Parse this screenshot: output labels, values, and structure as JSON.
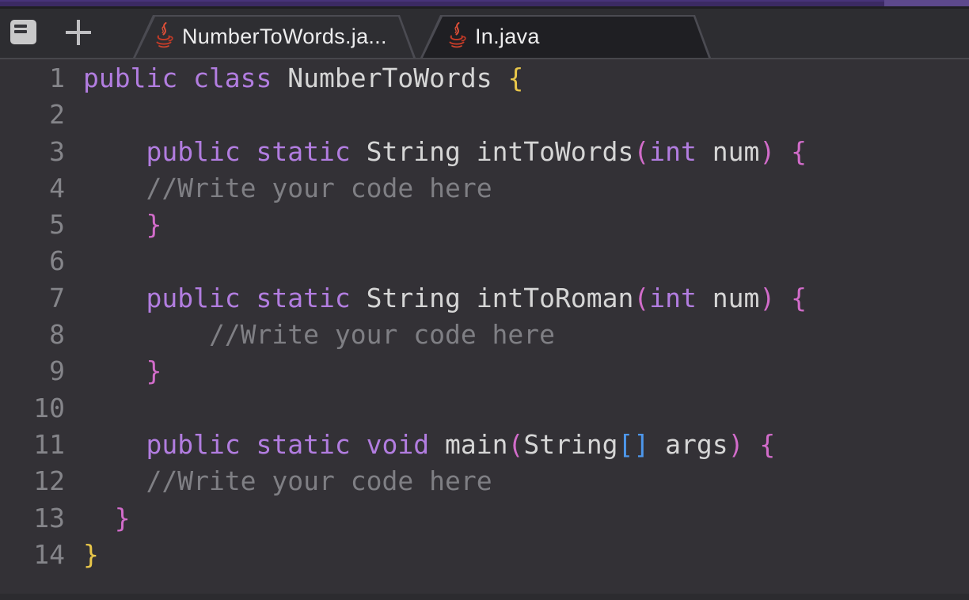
{
  "header": {
    "strip_color": "#3b2a63",
    "strip_accent_color": "#5d498c"
  },
  "toolbar": {
    "menu_icon": "file-list",
    "new_tab_icon": "plus"
  },
  "tabs": [
    {
      "label": "NumberToWords.ja...",
      "icon": "java-icon",
      "active": true
    },
    {
      "label": "In.java",
      "icon": "java-icon",
      "active": false
    }
  ],
  "editor": {
    "language": "java",
    "colors": {
      "kw": "#b27de0",
      "fg": "#d6d6d6",
      "cm": "#7f7f84",
      "b1": "#e8c64a",
      "b2": "#d26cca",
      "b3": "#4d97ec",
      "ln": "#85858a"
    },
    "lines": [
      {
        "num": "1",
        "tokens": [
          [
            "kw",
            "public class"
          ],
          [
            "fg",
            " NumberToWords "
          ],
          [
            "b1",
            "{"
          ]
        ]
      },
      {
        "num": "2",
        "tokens": []
      },
      {
        "num": "3",
        "tokens": [
          [
            "fg",
            "    "
          ],
          [
            "kw",
            "public static"
          ],
          [
            "fg",
            " String intToWords"
          ],
          [
            "b2",
            "("
          ],
          [
            "kw",
            "int"
          ],
          [
            "fg",
            " num"
          ],
          [
            "b2",
            ")"
          ],
          [
            "fg",
            " "
          ],
          [
            "b2",
            "{"
          ]
        ]
      },
      {
        "num": "4",
        "tokens": [
          [
            "cm",
            "    //Write your code here"
          ]
        ]
      },
      {
        "num": "5",
        "tokens": [
          [
            "fg",
            "    "
          ],
          [
            "b2",
            "}"
          ]
        ]
      },
      {
        "num": "6",
        "tokens": []
      },
      {
        "num": "7",
        "tokens": [
          [
            "fg",
            "    "
          ],
          [
            "kw",
            "public static"
          ],
          [
            "fg",
            " String intToRoman"
          ],
          [
            "b2",
            "("
          ],
          [
            "kw",
            "int"
          ],
          [
            "fg",
            " num"
          ],
          [
            "b2",
            ")"
          ],
          [
            "fg",
            " "
          ],
          [
            "b2",
            "{"
          ]
        ]
      },
      {
        "num": "8",
        "tokens": [
          [
            "cm",
            "        //Write your code here"
          ]
        ]
      },
      {
        "num": "9",
        "tokens": [
          [
            "fg",
            "    "
          ],
          [
            "b2",
            "}"
          ]
        ]
      },
      {
        "num": "10",
        "tokens": []
      },
      {
        "num": "11",
        "tokens": [
          [
            "fg",
            "    "
          ],
          [
            "kw",
            "public static void"
          ],
          [
            "fg",
            " main"
          ],
          [
            "b2",
            "("
          ],
          [
            "fg",
            "String"
          ],
          [
            "b3",
            "[]"
          ],
          [
            "fg",
            " args"
          ],
          [
            "b2",
            ")"
          ],
          [
            "fg",
            " "
          ],
          [
            "b2",
            "{"
          ]
        ]
      },
      {
        "num": "12",
        "tokens": [
          [
            "cm",
            "    //Write your code here"
          ]
        ]
      },
      {
        "num": "13",
        "tokens": [
          [
            "fg",
            "  "
          ],
          [
            "b2",
            "}"
          ]
        ]
      },
      {
        "num": "14",
        "tokens": [
          [
            "b1",
            "}"
          ]
        ]
      }
    ]
  }
}
